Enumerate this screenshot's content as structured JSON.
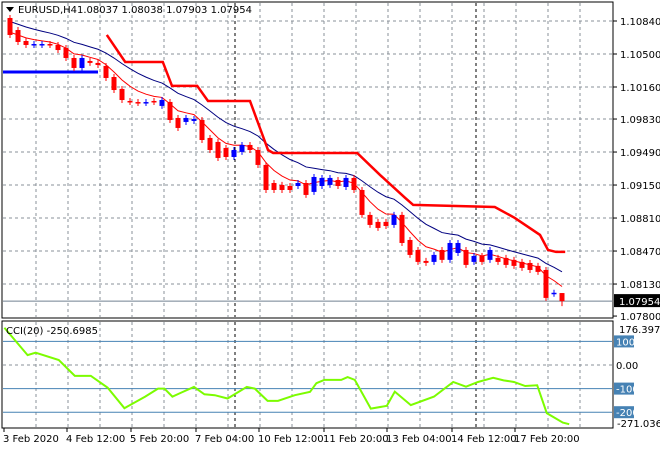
{
  "header": {
    "menu_icon": "triangle-down-icon",
    "symbol": "EURUSD,H4",
    "ohlc": "1.08037 1.08038 1.07903 1.07954"
  },
  "price_axis": {
    "ticks": [
      "1.10840",
      "1.10500",
      "1.10160",
      "1.09830",
      "1.09490",
      "1.09150",
      "1.08810",
      "1.08470",
      "1.08130",
      "1.07800"
    ],
    "current_price": "1.07954"
  },
  "cci": {
    "title": "CCI(20) -250.6985",
    "scale_max": "176.397",
    "scale_min": "-271.0364",
    "levels": [
      "100",
      "0.00",
      "-100",
      "-200"
    ]
  },
  "time_axis": {
    "labels": [
      "3 Feb 2020",
      "4 Feb 12:00",
      "5 Feb 20:00",
      "7 Feb 04:00",
      "10 Feb 12:00",
      "11 Feb 20:00",
      "13 Feb 04:00",
      "14 Feb 12:00",
      "17 Feb 20:00"
    ]
  },
  "colors": {
    "bull": "#0000ff",
    "bear": "#ff0000",
    "slow_ma": "#000080",
    "fast_ma": "#ff0000",
    "stop_line": "#ff0000",
    "support": "#0000ff",
    "cci": "#7cfc00",
    "level": "#4682b4"
  },
  "chart_data": [
    {
      "type": "candlestick",
      "title": "EURUSD,H4",
      "ylim": [
        1.0778,
        1.11036
      ],
      "candles_open_close": [
        [
          1.10871,
          1.10696
        ],
        [
          1.10747,
          1.10624
        ],
        [
          1.10634,
          1.10593
        ],
        [
          1.10593,
          1.10603
        ],
        [
          1.10593,
          1.10603
        ],
        [
          1.10603,
          1.10593
        ],
        [
          1.10593,
          1.10541
        ],
        [
          1.10562,
          1.10459
        ],
        [
          1.10459,
          1.10356
        ],
        [
          1.10356,
          1.10459
        ],
        [
          1.10428,
          1.10408
        ],
        [
          1.10408,
          1.10387
        ],
        [
          1.10377,
          1.10253
        ],
        [
          1.10263,
          1.10129
        ],
        [
          1.1014,
          1.10026
        ],
        [
          1.10016,
          1.10006
        ],
        [
          1.10005,
          1.09995
        ],
        [
          1.09995,
          1.10005
        ],
        [
          1.10016,
          1.10006
        ],
        [
          1.09965,
          1.10026
        ],
        [
          1.10006,
          1.0982
        ],
        [
          1.09841,
          1.09738
        ],
        [
          1.098,
          1.09841
        ],
        [
          1.0981,
          1.0983
        ],
        [
          1.0982,
          1.09614
        ],
        [
          1.09635,
          1.09511
        ],
        [
          1.09594,
          1.09429
        ],
        [
          1.09532,
          1.09439
        ],
        [
          1.09439,
          1.09511
        ],
        [
          1.09491,
          1.09563
        ],
        [
          1.09563,
          1.09511
        ],
        [
          1.09511,
          1.09357
        ],
        [
          1.09357,
          1.09099
        ],
        [
          1.09171,
          1.09099
        ],
        [
          1.09151,
          1.09099
        ],
        [
          1.0914,
          1.09099
        ],
        [
          1.0914,
          1.09171
        ],
        [
          1.09171,
          1.09048
        ],
        [
          1.09079,
          1.09233
        ],
        [
          1.0914,
          1.09223
        ],
        [
          1.09151,
          1.09223
        ],
        [
          1.09202,
          1.0914
        ],
        [
          1.0913,
          1.09223
        ],
        [
          1.09223,
          1.09099
        ],
        [
          1.09099,
          1.08842
        ],
        [
          1.08842,
          1.08739
        ],
        [
          1.0877,
          1.08708
        ],
        [
          1.0877,
          1.08728
        ],
        [
          1.08739,
          1.08842
        ],
        [
          1.08842,
          1.08553
        ],
        [
          1.08584,
          1.0843
        ],
        [
          1.08481,
          1.08358
        ],
        [
          1.08368,
          1.08348
        ],
        [
          1.08358,
          1.0843
        ],
        [
          1.08481,
          1.08379
        ],
        [
          1.08379,
          1.08553
        ],
        [
          1.0845,
          1.08553
        ],
        [
          1.08481,
          1.08327
        ],
        [
          1.08358,
          1.08419
        ],
        [
          1.08419,
          1.08358
        ],
        [
          1.08379,
          1.08481
        ],
        [
          1.08399,
          1.08358
        ],
        [
          1.08399,
          1.08327
        ],
        [
          1.08379,
          1.08317
        ],
        [
          1.08358,
          1.08296
        ],
        [
          1.08347,
          1.08275
        ],
        [
          1.08317,
          1.08255
        ],
        [
          1.08275,
          1.07987
        ],
        [
          1.0803,
          1.0804
        ],
        [
          1.08037,
          1.07954
        ]
      ],
      "last_candle": {
        "open": 1.08037,
        "high": 1.08038,
        "low": 1.07903,
        "close": 1.07954
      },
      "stop_line_breakpoints": [
        [
          12.1,
          1.10696
        ],
        [
          14.4,
          1.10418
        ],
        [
          19.1,
          1.10418
        ],
        [
          20.25,
          1.10171
        ],
        [
          23.4,
          1.10171
        ],
        [
          24.75,
          1.10016
        ],
        [
          30,
          1.10016
        ],
        [
          32.25,
          1.09511
        ],
        [
          32.9,
          1.0948
        ],
        [
          43.4,
          1.0948
        ],
        [
          46.25,
          1.09254
        ],
        [
          49.4,
          1.09017
        ],
        [
          50.4,
          1.08945
        ],
        [
          60.6,
          1.08924
        ],
        [
          63.1,
          1.08811
        ],
        [
          66.25,
          1.08636
        ],
        [
          67.25,
          1.08481
        ],
        [
          68.25,
          1.08461
        ],
        [
          69.4,
          1.08461
        ]
      ],
      "support_line": {
        "price": 1.10315,
        "from_index": -1,
        "to_index": 11
      }
    },
    {
      "type": "line",
      "title": "CCI(20)",
      "ylim": [
        -271.0364,
        176.397
      ],
      "levels": [
        100,
        0,
        -100,
        -200
      ],
      "points": [
        [
          -0.7,
          158
        ],
        [
          2.2,
          42
        ],
        [
          3.2,
          52
        ],
        [
          6.1,
          21
        ],
        [
          8.1,
          -46
        ],
        [
          10.1,
          -46
        ],
        [
          12.2,
          -96
        ],
        [
          14.3,
          -183
        ],
        [
          16.9,
          -134
        ],
        [
          18.5,
          -100
        ],
        [
          19.3,
          -100
        ],
        [
          20.3,
          -134
        ],
        [
          21.4,
          -117
        ],
        [
          23,
          -93
        ],
        [
          24.3,
          -124
        ],
        [
          25.6,
          -128
        ],
        [
          27.2,
          -142
        ],
        [
          29.6,
          -93
        ],
        [
          30.6,
          -100
        ],
        [
          32.2,
          -152
        ],
        [
          33.5,
          -152
        ],
        [
          35.6,
          -128
        ],
        [
          37.5,
          -114
        ],
        [
          38.3,
          -77
        ],
        [
          39.3,
          -63
        ],
        [
          41.4,
          -63
        ],
        [
          42.2,
          -51
        ],
        [
          43.1,
          -63
        ],
        [
          45.1,
          -185
        ],
        [
          47.1,
          -173
        ],
        [
          48.1,
          -113
        ],
        [
          50.1,
          -170
        ],
        [
          53,
          -134
        ],
        [
          55.4,
          -72
        ],
        [
          57,
          -92
        ],
        [
          58.5,
          -72
        ],
        [
          60.4,
          -54
        ],
        [
          61.7,
          -65
        ],
        [
          63,
          -72
        ],
        [
          64.4,
          -89
        ],
        [
          65.9,
          -86
        ],
        [
          67.1,
          -204
        ],
        [
          69.1,
          -244
        ],
        [
          69.9,
          -250.7
        ]
      ]
    }
  ]
}
